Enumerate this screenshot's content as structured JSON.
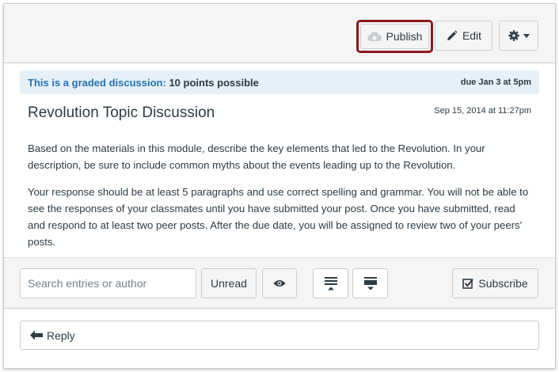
{
  "header": {
    "publish_label": "Publish",
    "edit_label": "Edit"
  },
  "banner": {
    "graded_label": "This is a graded discussion:",
    "points": "10 points possible",
    "due": "due Jan 3 at 5pm"
  },
  "topic": {
    "title": "Revolution Topic Discussion",
    "posted": "Sep 15, 2014 at 11:27pm",
    "paragraphs": [
      "Based on the materials in this module, describe the key elements that led to the Revolution. In your description, be sure to include common myths about the events leading up to the Revolution.",
      "Your response should be at least 5 paragraphs and use correct spelling and grammar. You will not be able to see the responses of your classmates until you have submitted your post. Once you have submitted, read and respond to at least two peer posts. After the due date, you will be assigned to review two of your peers' posts."
    ]
  },
  "toolbar": {
    "search_placeholder": "Search entries or author",
    "unread_label": "Unread",
    "subscribe_label": "Subscribe"
  },
  "reply": {
    "label": "Reply"
  },
  "colors": {
    "publish_outline": "#8b1a1a",
    "banner_bg": "#e5f0f8",
    "banner_text": "#2472b4"
  }
}
